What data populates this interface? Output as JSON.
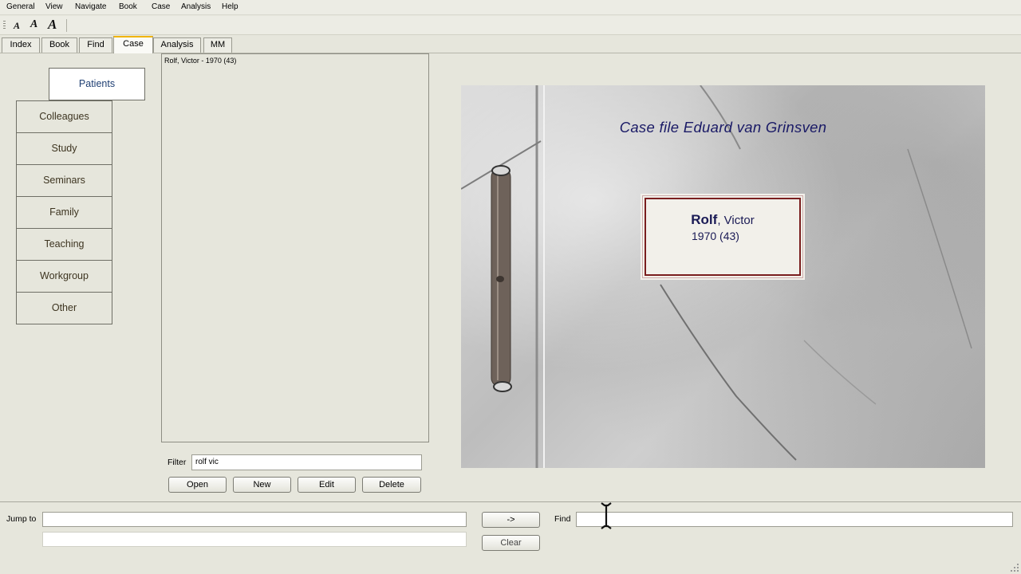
{
  "menu": [
    "General",
    "View",
    "Navigate",
    "Book",
    "Case",
    "Analysis",
    "Help"
  ],
  "toolbar": {
    "font_small": "A",
    "font_medium": "A",
    "font_large": "A"
  },
  "tabs": [
    "Index",
    "Book",
    "Find",
    "Case",
    "Analysis",
    "MM"
  ],
  "categories": [
    "Patients",
    "Colleagues",
    "Study",
    "Seminars",
    "Family",
    "Teaching",
    "Workgroup",
    "Other"
  ],
  "patients": [
    "Rolf, Victor - 1970 (43)"
  ],
  "filter": {
    "label": "Filter",
    "value": "rolf vic"
  },
  "buttons": {
    "open": "Open",
    "new": "New",
    "edit": "Edit",
    "delete": "Delete"
  },
  "case_file": {
    "title": "Case file Eduard van Grinsven",
    "surname": "Rolf",
    "given": ", Victor",
    "year": "1970 (43)"
  },
  "bottom": {
    "jump_label": "Jump to",
    "jump_value": "",
    "go_label": "->",
    "clear_label": "Clear",
    "find_label": "Find",
    "find_value": ""
  }
}
